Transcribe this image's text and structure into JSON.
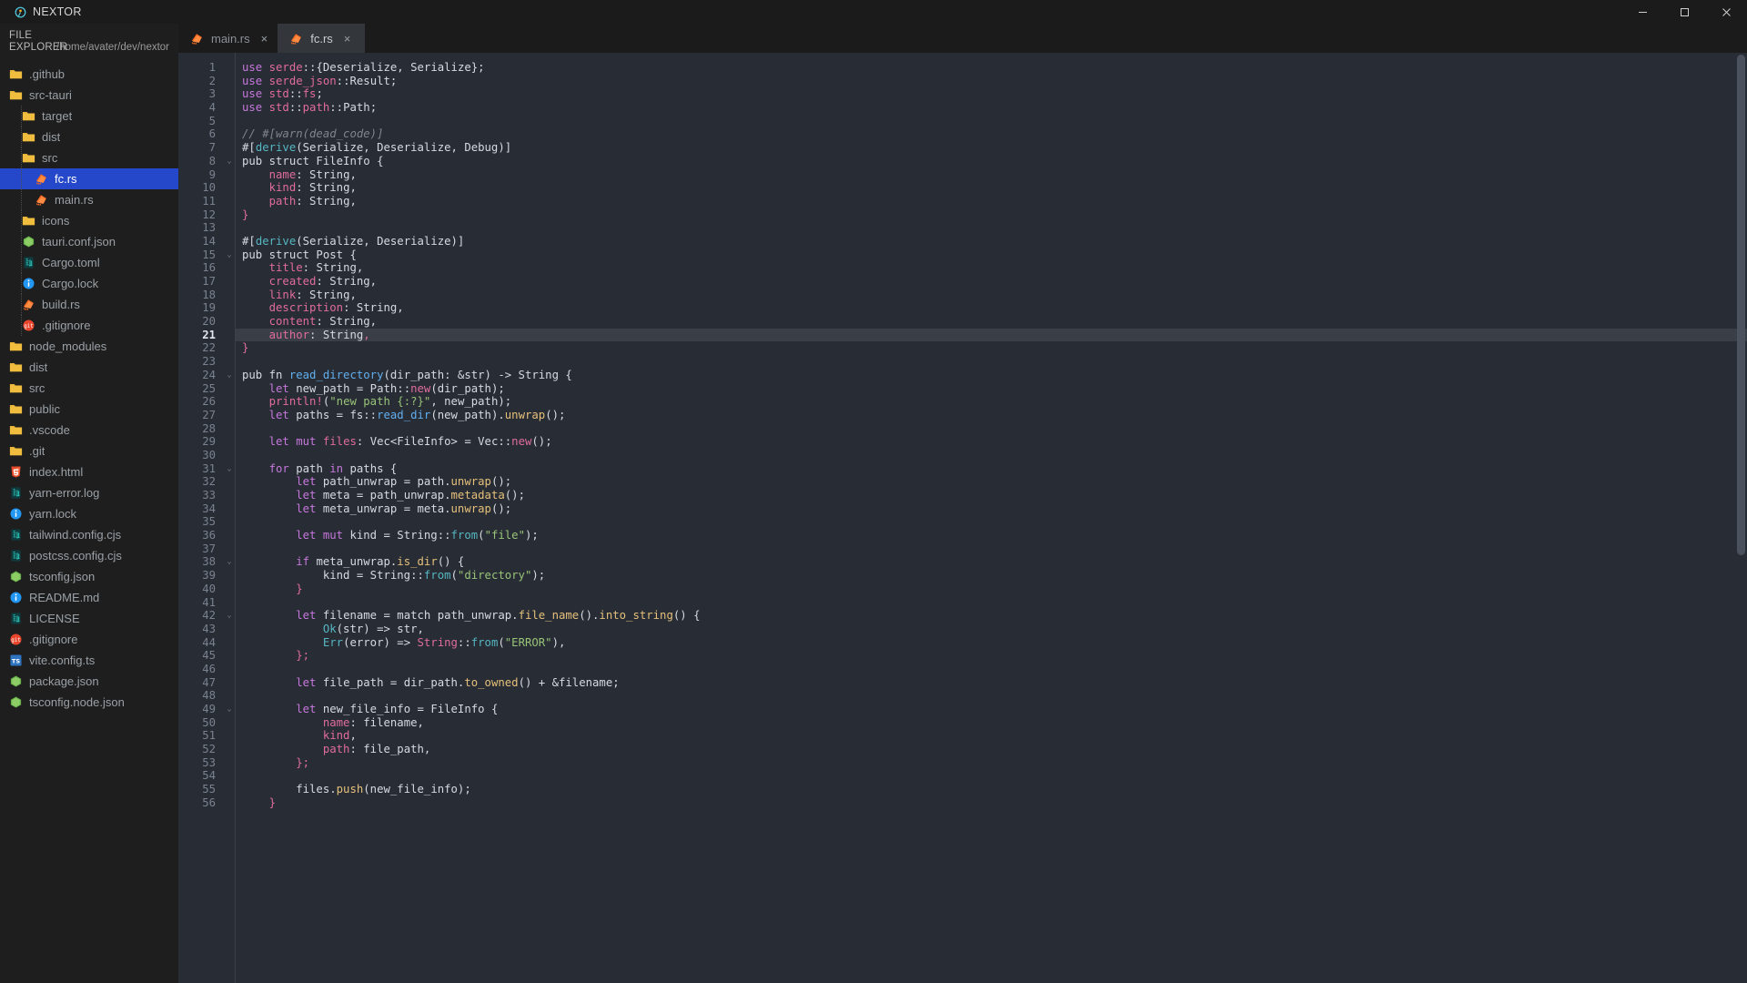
{
  "window": {
    "app_name": "NEXTOR",
    "logo_icon": "nextor-logo-icon",
    "minimize_label": "−",
    "maximize_label": "☐",
    "close_label": "×"
  },
  "sidebar": {
    "header_title": "FILE EXPLORER",
    "header_title_line1": "FILE",
    "header_title_line2": "EXPLORER",
    "path": "/home/avater/dev/nextor",
    "items": [
      {
        "label": ".github",
        "icon": "folder-icon",
        "depth": 0,
        "selected": false
      },
      {
        "label": "src-tauri",
        "icon": "folder-icon",
        "depth": 0,
        "selected": false
      },
      {
        "label": "target",
        "icon": "folder-icon",
        "depth": 1,
        "selected": false
      },
      {
        "label": "dist",
        "icon": "folder-icon",
        "depth": 1,
        "selected": false
      },
      {
        "label": "src",
        "icon": "folder-icon",
        "depth": 1,
        "selected": false
      },
      {
        "label": "fc.rs",
        "icon": "rust-icon",
        "depth": 2,
        "selected": true
      },
      {
        "label": "main.rs",
        "icon": "rust-icon",
        "depth": 2,
        "selected": false
      },
      {
        "label": "icons",
        "icon": "folder-icon",
        "depth": 1,
        "selected": false
      },
      {
        "label": "tauri.conf.json",
        "icon": "node-icon",
        "depth": 1,
        "selected": false
      },
      {
        "label": "Cargo.toml",
        "icon": "circuit-icon",
        "depth": 1,
        "selected": false
      },
      {
        "label": "Cargo.lock",
        "icon": "info-icon",
        "depth": 1,
        "selected": false
      },
      {
        "label": "build.rs",
        "icon": "rust-icon",
        "depth": 1,
        "selected": false
      },
      {
        "label": ".gitignore",
        "icon": "git-icon",
        "depth": 1,
        "selected": false
      },
      {
        "label": "node_modules",
        "icon": "folder-icon",
        "depth": 0,
        "selected": false
      },
      {
        "label": "dist",
        "icon": "folder-icon",
        "depth": 0,
        "selected": false
      },
      {
        "label": "src",
        "icon": "folder-icon",
        "depth": 0,
        "selected": false
      },
      {
        "label": "public",
        "icon": "folder-icon",
        "depth": 0,
        "selected": false
      },
      {
        "label": ".vscode",
        "icon": "folder-icon",
        "depth": 0,
        "selected": false
      },
      {
        "label": ".git",
        "icon": "folder-icon",
        "depth": 0,
        "selected": false
      },
      {
        "label": "index.html",
        "icon": "html5-icon",
        "depth": 0,
        "selected": false
      },
      {
        "label": "yarn-error.log",
        "icon": "circuit-icon",
        "depth": 0,
        "selected": false
      },
      {
        "label": "yarn.lock",
        "icon": "info-icon",
        "depth": 0,
        "selected": false
      },
      {
        "label": "tailwind.config.cjs",
        "icon": "circuit-icon",
        "depth": 0,
        "selected": false
      },
      {
        "label": "postcss.config.cjs",
        "icon": "circuit-icon",
        "depth": 0,
        "selected": false
      },
      {
        "label": "tsconfig.json",
        "icon": "node-icon",
        "depth": 0,
        "selected": false
      },
      {
        "label": "README.md",
        "icon": "info-icon",
        "depth": 0,
        "selected": false
      },
      {
        "label": "LICENSE",
        "icon": "circuit-icon",
        "depth": 0,
        "selected": false
      },
      {
        "label": ".gitignore",
        "icon": "git-icon",
        "depth": 0,
        "selected": false
      },
      {
        "label": "vite.config.ts",
        "icon": "ts-icon",
        "depth": 0,
        "selected": false
      },
      {
        "label": "package.json",
        "icon": "node-icon",
        "depth": 0,
        "selected": false
      },
      {
        "label": "tsconfig.node.json",
        "icon": "node-icon",
        "depth": 0,
        "selected": false
      }
    ]
  },
  "tabs": [
    {
      "label": "main.rs",
      "icon": "rust-icon",
      "active": false,
      "close_label": "×"
    },
    {
      "label": "fc.rs",
      "icon": "rust-icon",
      "active": true,
      "close_label": "×"
    }
  ],
  "editor": {
    "active_line": 21,
    "first_line": 1,
    "last_line": 56,
    "fold_lines": [
      8,
      15,
      24,
      31,
      38,
      42,
      49
    ],
    "lines": [
      {
        "n": 1,
        "tokens": [
          [
            "t-kw",
            "use "
          ],
          [
            "t-mod",
            "serde"
          ],
          [
            "t-def",
            "::{"
          ],
          [
            "t-def",
            "Deserialize, Serialize"
          ],
          [
            "t-def",
            "};"
          ]
        ]
      },
      {
        "n": 2,
        "tokens": [
          [
            "t-kw",
            "use "
          ],
          [
            "t-mod",
            "serde_json"
          ],
          [
            "t-def",
            "::"
          ],
          [
            "t-def",
            "Result;"
          ]
        ]
      },
      {
        "n": 3,
        "tokens": [
          [
            "t-kw",
            "use "
          ],
          [
            "t-mod",
            "std"
          ],
          [
            "t-def",
            "::"
          ],
          [
            "t-mod",
            "fs"
          ],
          [
            "t-def",
            ";"
          ]
        ]
      },
      {
        "n": 4,
        "tokens": [
          [
            "t-kw",
            "use "
          ],
          [
            "t-mod",
            "std"
          ],
          [
            "t-def",
            "::"
          ],
          [
            "t-mod",
            "path"
          ],
          [
            "t-def",
            "::"
          ],
          [
            "t-def",
            "Path;"
          ]
        ]
      },
      {
        "n": 5,
        "tokens": []
      },
      {
        "n": 6,
        "tokens": [
          [
            "t-cmt",
            "// #[warn(dead_code)]"
          ]
        ]
      },
      {
        "n": 7,
        "tokens": [
          [
            "t-def",
            "#["
          ],
          [
            "t-attr",
            "derive"
          ],
          [
            "t-def",
            "(Serialize, Deserialize, Debug)]"
          ]
        ]
      },
      {
        "n": 8,
        "tokens": [
          [
            "t-def",
            "pub struct FileInfo {"
          ]
        ]
      },
      {
        "n": 9,
        "tokens": [
          [
            "t-def",
            "    "
          ],
          [
            "t-fld",
            "name"
          ],
          [
            "t-def",
            ": String,"
          ]
        ]
      },
      {
        "n": 10,
        "tokens": [
          [
            "t-def",
            "    "
          ],
          [
            "t-fld",
            "kind"
          ],
          [
            "t-def",
            ": String,"
          ]
        ]
      },
      {
        "n": 11,
        "tokens": [
          [
            "t-def",
            "    "
          ],
          [
            "t-fld",
            "path"
          ],
          [
            "t-def",
            ": String,"
          ]
        ]
      },
      {
        "n": 12,
        "tokens": [
          [
            "t-mod",
            "}"
          ]
        ]
      },
      {
        "n": 13,
        "tokens": []
      },
      {
        "n": 14,
        "tokens": [
          [
            "t-def",
            "#["
          ],
          [
            "t-attr",
            "derive"
          ],
          [
            "t-def",
            "(Serialize, Deserialize)]"
          ]
        ]
      },
      {
        "n": 15,
        "tokens": [
          [
            "t-def",
            "pub struct Post {"
          ]
        ]
      },
      {
        "n": 16,
        "tokens": [
          [
            "t-def",
            "    "
          ],
          [
            "t-fld",
            "title"
          ],
          [
            "t-def",
            ": String,"
          ]
        ]
      },
      {
        "n": 17,
        "tokens": [
          [
            "t-def",
            "    "
          ],
          [
            "t-fld",
            "created"
          ],
          [
            "t-def",
            ": String,"
          ]
        ]
      },
      {
        "n": 18,
        "tokens": [
          [
            "t-def",
            "    "
          ],
          [
            "t-fld",
            "link"
          ],
          [
            "t-def",
            ": String,"
          ]
        ]
      },
      {
        "n": 19,
        "tokens": [
          [
            "t-def",
            "    "
          ],
          [
            "t-fld",
            "description"
          ],
          [
            "t-def",
            ": String,"
          ]
        ]
      },
      {
        "n": 20,
        "tokens": [
          [
            "t-def",
            "    "
          ],
          [
            "t-fld",
            "content"
          ],
          [
            "t-def",
            ": String,"
          ]
        ]
      },
      {
        "n": 21,
        "tokens": [
          [
            "t-def",
            "    "
          ],
          [
            "t-fld",
            "author"
          ],
          [
            "t-def",
            ": String"
          ],
          [
            "t-mod",
            ","
          ]
        ]
      },
      {
        "n": 22,
        "tokens": [
          [
            "t-mod",
            "}"
          ]
        ]
      },
      {
        "n": 23,
        "tokens": []
      },
      {
        "n": 24,
        "tokens": [
          [
            "t-def",
            "pub fn "
          ],
          [
            "t-fnc",
            "read_directory"
          ],
          [
            "t-def",
            "(dir_path: &str) -> String {"
          ]
        ]
      },
      {
        "n": 25,
        "tokens": [
          [
            "t-def",
            "    "
          ],
          [
            "t-kw",
            "let "
          ],
          [
            "t-def",
            "new_path = Path::"
          ],
          [
            "t-mod",
            "new"
          ],
          [
            "t-def",
            "(dir_path);"
          ]
        ]
      },
      {
        "n": 26,
        "tokens": [
          [
            "t-def",
            "    "
          ],
          [
            "t-mod",
            "println!"
          ],
          [
            "t-def",
            "("
          ],
          [
            "t-str",
            "\"new path {:?}\""
          ],
          [
            "t-def",
            ", new_path);"
          ]
        ]
      },
      {
        "n": 27,
        "tokens": [
          [
            "t-def",
            "    "
          ],
          [
            "t-kw",
            "let "
          ],
          [
            "t-def",
            "paths = fs::"
          ],
          [
            "t-fnc",
            "read_dir"
          ],
          [
            "t-def",
            "(new_path)."
          ],
          [
            "t-mth",
            "unwrap"
          ],
          [
            "t-def",
            "();"
          ]
        ]
      },
      {
        "n": 28,
        "tokens": []
      },
      {
        "n": 29,
        "tokens": [
          [
            "t-def",
            "    "
          ],
          [
            "t-kw",
            "let mut "
          ],
          [
            "t-fld",
            "files"
          ],
          [
            "t-def",
            ": Vec<FileInfo> = Vec::"
          ],
          [
            "t-mod",
            "new"
          ],
          [
            "t-def",
            "();"
          ]
        ]
      },
      {
        "n": 30,
        "tokens": []
      },
      {
        "n": 31,
        "tokens": [
          [
            "t-def",
            "    "
          ],
          [
            "t-kw",
            "for "
          ],
          [
            "t-def",
            "path "
          ],
          [
            "t-kw",
            "in "
          ],
          [
            "t-def",
            "paths {"
          ]
        ]
      },
      {
        "n": 32,
        "tokens": [
          [
            "t-def",
            "        "
          ],
          [
            "t-kw",
            "let "
          ],
          [
            "t-def",
            "path_unwrap = path."
          ],
          [
            "t-mth",
            "unwrap"
          ],
          [
            "t-def",
            "();"
          ]
        ]
      },
      {
        "n": 33,
        "tokens": [
          [
            "t-def",
            "        "
          ],
          [
            "t-kw",
            "let "
          ],
          [
            "t-def",
            "meta = path_unwrap."
          ],
          [
            "t-mth",
            "metadata"
          ],
          [
            "t-def",
            "();"
          ]
        ]
      },
      {
        "n": 34,
        "tokens": [
          [
            "t-def",
            "        "
          ],
          [
            "t-kw",
            "let "
          ],
          [
            "t-def",
            "meta_unwrap = meta."
          ],
          [
            "t-mth",
            "unwrap"
          ],
          [
            "t-def",
            "();"
          ]
        ]
      },
      {
        "n": 35,
        "tokens": []
      },
      {
        "n": 36,
        "tokens": [
          [
            "t-def",
            "        "
          ],
          [
            "t-kw",
            "let mut "
          ],
          [
            "t-def",
            "kind = String::"
          ],
          [
            "t-attr",
            "from"
          ],
          [
            "t-def",
            "("
          ],
          [
            "t-str",
            "\"file\""
          ],
          [
            "t-def",
            ");"
          ]
        ]
      },
      {
        "n": 37,
        "tokens": []
      },
      {
        "n": 38,
        "tokens": [
          [
            "t-def",
            "        "
          ],
          [
            "t-kw",
            "if "
          ],
          [
            "t-def",
            "meta_unwrap."
          ],
          [
            "t-mth",
            "is_dir"
          ],
          [
            "t-def",
            "() {"
          ]
        ]
      },
      {
        "n": 39,
        "tokens": [
          [
            "t-def",
            "            kind = String::"
          ],
          [
            "t-attr",
            "from"
          ],
          [
            "t-def",
            "("
          ],
          [
            "t-str",
            "\"directory\""
          ],
          [
            "t-def",
            ");"
          ]
        ]
      },
      {
        "n": 40,
        "tokens": [
          [
            "t-mod",
            "        }"
          ]
        ]
      },
      {
        "n": 41,
        "tokens": []
      },
      {
        "n": 42,
        "tokens": [
          [
            "t-def",
            "        "
          ],
          [
            "t-kw",
            "let "
          ],
          [
            "t-def",
            "filename = match path_unwrap."
          ],
          [
            "t-mth",
            "file_name"
          ],
          [
            "t-def",
            "()."
          ],
          [
            "t-mth",
            "into_string"
          ],
          [
            "t-def",
            "() {"
          ]
        ]
      },
      {
        "n": 43,
        "tokens": [
          [
            "t-def",
            "            "
          ],
          [
            "t-attr",
            "Ok"
          ],
          [
            "t-def",
            "(str) => str,"
          ]
        ]
      },
      {
        "n": 44,
        "tokens": [
          [
            "t-def",
            "            "
          ],
          [
            "t-attr",
            "Err"
          ],
          [
            "t-def",
            "(error) => "
          ],
          [
            "t-mod",
            "String"
          ],
          [
            "t-def",
            "::"
          ],
          [
            "t-attr",
            "from"
          ],
          [
            "t-def",
            "("
          ],
          [
            "t-str",
            "\"ERROR\""
          ],
          [
            "t-def",
            "),"
          ]
        ]
      },
      {
        "n": 45,
        "tokens": [
          [
            "t-mod",
            "        };"
          ]
        ]
      },
      {
        "n": 46,
        "tokens": []
      },
      {
        "n": 47,
        "tokens": [
          [
            "t-def",
            "        "
          ],
          [
            "t-kw",
            "let "
          ],
          [
            "t-def",
            "file_path = dir_path."
          ],
          [
            "t-mth",
            "to_owned"
          ],
          [
            "t-def",
            "() + &filename;"
          ]
        ]
      },
      {
        "n": 48,
        "tokens": []
      },
      {
        "n": 49,
        "tokens": [
          [
            "t-def",
            "        "
          ],
          [
            "t-kw",
            "let "
          ],
          [
            "t-def",
            "new_file_info = FileInfo {"
          ]
        ]
      },
      {
        "n": 50,
        "tokens": [
          [
            "t-def",
            "            "
          ],
          [
            "t-fld",
            "name"
          ],
          [
            "t-def",
            ": filename,"
          ]
        ]
      },
      {
        "n": 51,
        "tokens": [
          [
            "t-def",
            "            "
          ],
          [
            "t-fld",
            "kind"
          ],
          [
            "t-def",
            ","
          ]
        ]
      },
      {
        "n": 52,
        "tokens": [
          [
            "t-def",
            "            "
          ],
          [
            "t-fld",
            "path"
          ],
          [
            "t-def",
            ": file_path,"
          ]
        ]
      },
      {
        "n": 53,
        "tokens": [
          [
            "t-mod",
            "        };"
          ]
        ]
      },
      {
        "n": 54,
        "tokens": []
      },
      {
        "n": 55,
        "tokens": [
          [
            "t-def",
            "        files."
          ],
          [
            "t-mth",
            "push"
          ],
          [
            "t-def",
            "(new_file_info);"
          ]
        ]
      },
      {
        "n": 56,
        "tokens": [
          [
            "t-mod",
            "    }"
          ]
        ]
      }
    ]
  },
  "colors": {
    "accent_selection": "#2547c9",
    "editor_bg": "#282c34",
    "titlebar_bg": "#1b1b1b",
    "sidebar_bg": "#1e1e1e",
    "tab_active_bg": "#33363b"
  }
}
